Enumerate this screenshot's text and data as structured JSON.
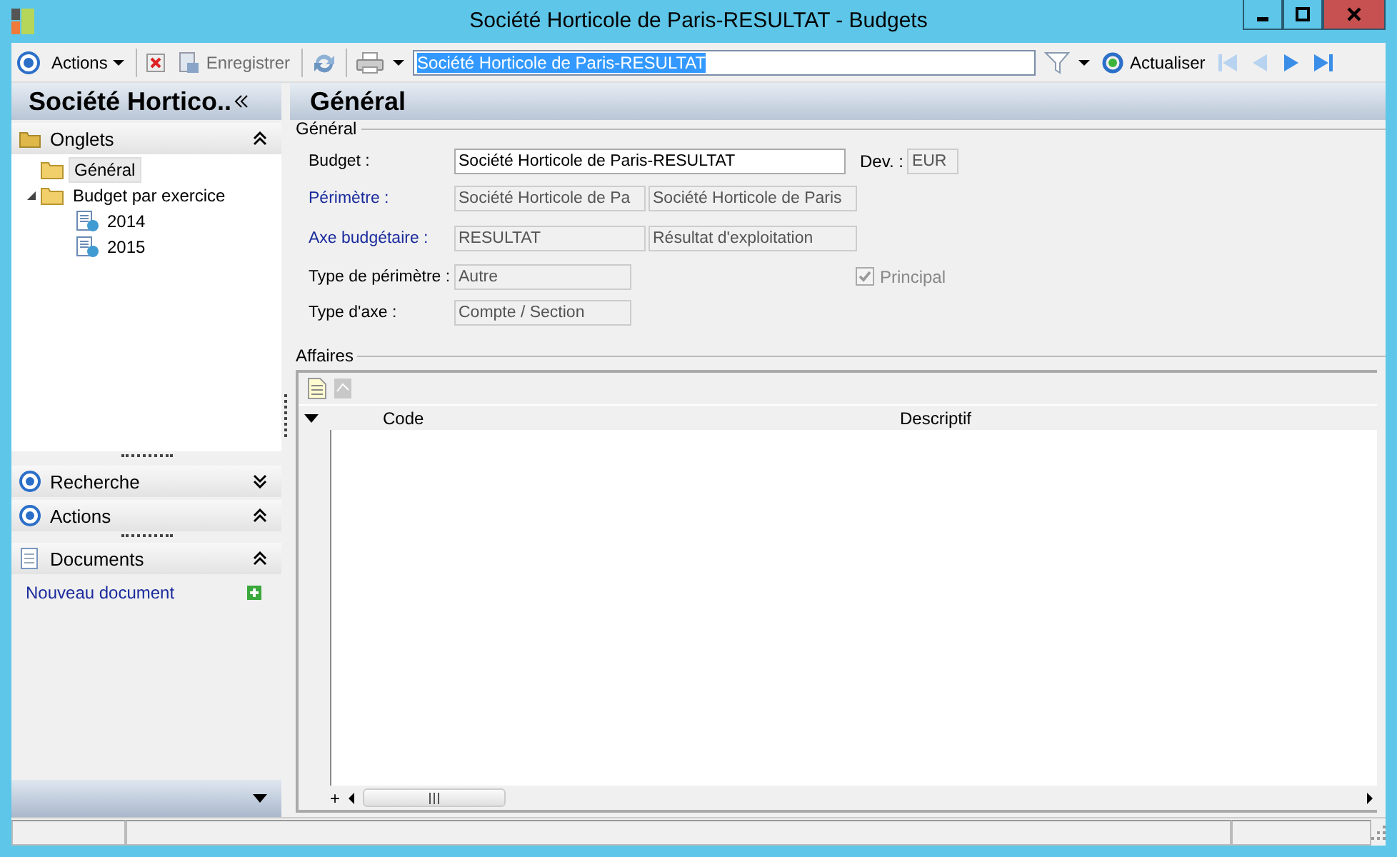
{
  "window": {
    "title": "Société Horticole de Paris-RESULTAT -  Budgets"
  },
  "toolbar": {
    "actions": "Actions",
    "save": {
      "label": "Enregistrer",
      "disabled": true
    },
    "search_value": "Société Horticole de Paris-RESULTAT",
    "refresh": "Actualiser",
    "nav_first_disabled": true,
    "nav_prev_disabled": true
  },
  "sidebar": {
    "title": "Société Hortico..",
    "tabs_section": {
      "label": "Onglets",
      "expanded": true
    },
    "tree": [
      {
        "label": "Général",
        "kind": "folder",
        "selected": true
      },
      {
        "label": "Budget par exercice",
        "kind": "folder",
        "selected": false,
        "expanded": true,
        "children": [
          {
            "label": "2014",
            "kind": "doc",
            "selected": false
          },
          {
            "label": "2015",
            "kind": "doc",
            "selected": false
          }
        ]
      }
    ],
    "sections": [
      {
        "label": "Recherche",
        "kind": "target",
        "expanded": false
      },
      {
        "label": "Actions",
        "kind": "target",
        "expanded": true
      },
      {
        "label": "Documents",
        "kind": "doc",
        "expanded": true
      }
    ],
    "documents_link": "Nouveau document"
  },
  "page_title": "Général",
  "general_group": {
    "title": "Général",
    "rows": [
      {
        "label": "Budget :",
        "kind": "text",
        "link": false,
        "fields": [
          {
            "value": "Société Horticole de Paris-RESULTAT",
            "disabled": false
          }
        ],
        "aside": {
          "kind": "field",
          "label": "Dev. :",
          "value": "EUR",
          "disabled": true
        }
      },
      {
        "label": "Périmètre :",
        "kind": "lookup",
        "link": true,
        "fields": [
          {
            "value": "Société Horticole de Pa",
            "disabled": true
          },
          {
            "value": "Société Horticole de Paris",
            "disabled": true
          }
        ]
      },
      {
        "label": "Axe budgétaire :",
        "kind": "lookup",
        "link": true,
        "fields": [
          {
            "value": "RESULTAT",
            "disabled": true
          },
          {
            "value": "Résultat d'exploitation",
            "disabled": true
          }
        ]
      },
      {
        "label": "Type de périmètre :",
        "kind": "choice",
        "link": false,
        "fields": [
          {
            "value": "Autre",
            "disabled": true
          }
        ],
        "aside": {
          "kind": "checkbox",
          "label": "Principal",
          "checked": true,
          "disabled": true
        }
      },
      {
        "label": "Type d'axe :",
        "kind": "choice",
        "link": false,
        "fields": [
          {
            "value": "Compte / Section",
            "disabled": true
          }
        ]
      }
    ]
  },
  "affaires_group": {
    "title": "Affaires",
    "columns": [
      "Code",
      "Descriptif"
    ],
    "add_symbol": "+"
  }
}
